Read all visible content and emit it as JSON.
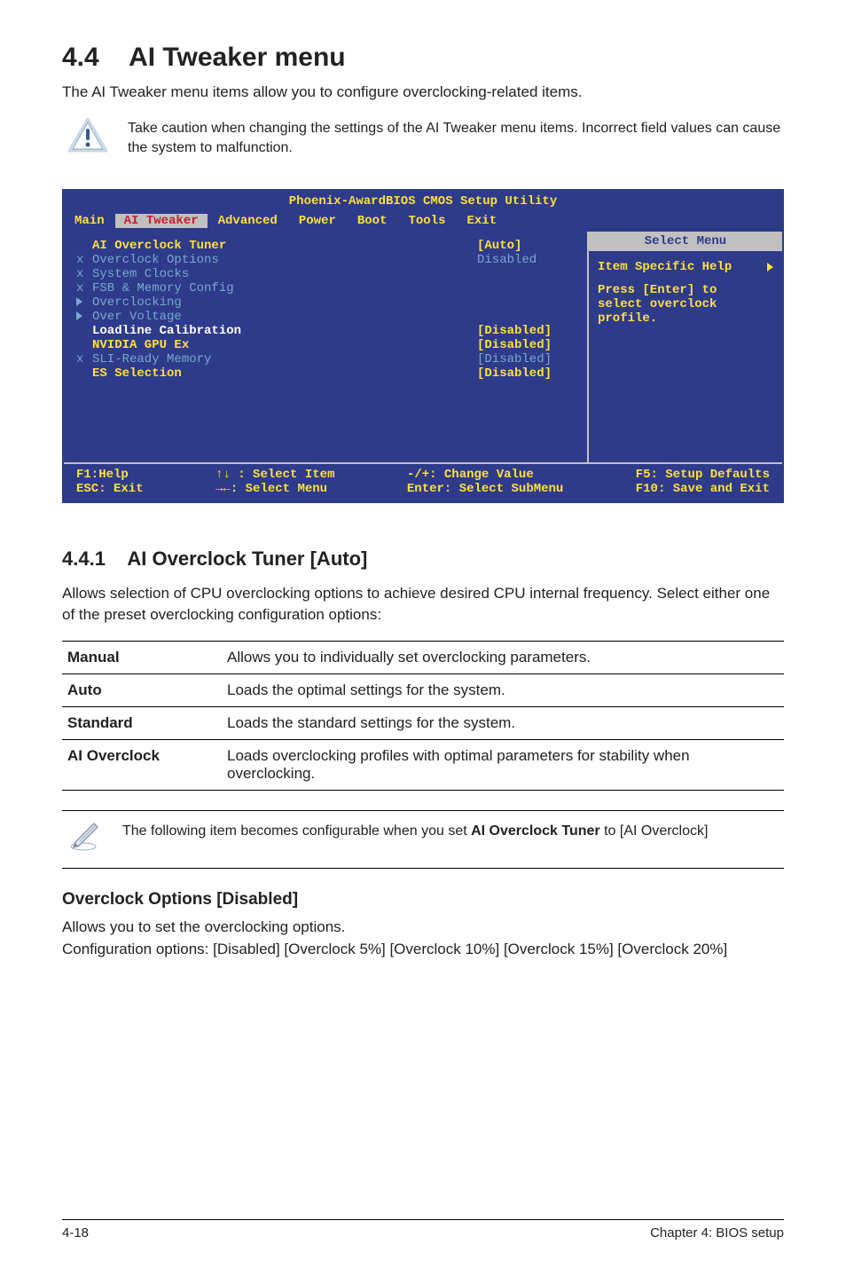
{
  "section": {
    "number": "4.4",
    "title": "AI Tweaker menu",
    "intro": "The AI Tweaker menu items allow you to configure overclocking-related items.",
    "caution": "Take caution when changing the settings of the AI Tweaker menu items. Incorrect field values can cause the system to malfunction."
  },
  "bios": {
    "window_title": "Phoenix-AwardBIOS CMOS Setup Utility",
    "tabs": [
      "Main",
      "AI Tweaker",
      "Advanced",
      "Power",
      "Boot",
      "Tools",
      "Exit"
    ],
    "active_tab": "AI Tweaker",
    "help_panel": {
      "header": "Select Menu",
      "title": "Item Specific Help",
      "body1": "Press [Enter] to",
      "body2": "select overclock",
      "body3": "profile."
    },
    "rows": [
      {
        "marker": "",
        "label": "AI Overclock Tuner",
        "value": "[Auto]",
        "bright": true,
        "white": false,
        "tri": false
      },
      {
        "marker": "x",
        "label": "Overclock Options",
        "value": "Disabled",
        "bright": false,
        "white": false,
        "tri": false,
        "plainval": true
      },
      {
        "marker": "x",
        "label": "System Clocks",
        "value": "",
        "bright": false,
        "white": false,
        "tri": false
      },
      {
        "marker": "x",
        "label": "FSB & Memory Config",
        "value": "",
        "bright": false,
        "white": false,
        "tri": false
      },
      {
        "marker": "",
        "label": "Overclocking",
        "value": "",
        "bright": false,
        "white": false,
        "tri": true
      },
      {
        "marker": "",
        "label": "Over Voltage",
        "value": "",
        "bright": false,
        "white": false,
        "tri": true
      },
      {
        "marker": "",
        "label": "Loadline Calibration",
        "value": "[Disabled]",
        "bright": true,
        "white": true,
        "tri": false
      },
      {
        "marker": "",
        "label": "NVIDIA GPU Ex",
        "value": "[Disabled]",
        "bright": true,
        "white": false,
        "tri": false
      },
      {
        "marker": "x",
        "label": "SLI-Ready Memory",
        "value": "[Disabled]",
        "bright": false,
        "white": false,
        "tri": false
      },
      {
        "marker": "",
        "label": "ES Selection",
        "value": "[Disabled]",
        "bright": true,
        "white": false,
        "tri": false
      }
    ],
    "footer": {
      "col1a": "F1:Help",
      "col1b": "ESC: Exit",
      "col2a": "↑↓ : Select Item",
      "col2b": "→←: Select Menu",
      "col3a": "-/+: Change Value",
      "col3b": "Enter: Select SubMenu",
      "col4a": "F5: Setup Defaults",
      "col4b": "F10: Save and Exit"
    }
  },
  "sub441": {
    "number": "4.4.1",
    "title": "AI Overclock Tuner [Auto]",
    "desc": "Allows selection of CPU overclocking options to achieve desired CPU internal frequency. Select either one of the preset overclocking configuration options:",
    "rows": [
      {
        "name": "Manual",
        "desc": "Allows you to individually set overclocking parameters."
      },
      {
        "name": "Auto",
        "desc": "Loads the optimal settings for the system."
      },
      {
        "name": "Standard",
        "desc": "Loads the standard settings for the system."
      },
      {
        "name": "AI Overclock",
        "desc": "Loads overclocking profiles with optimal parameters for stability when overclocking."
      }
    ],
    "note_pre": "The following item becomes configurable when you set ",
    "note_bold": "AI Overclock Tuner",
    "note_post": " to [AI Overclock]"
  },
  "overclock": {
    "heading": "Overclock Options [Disabled]",
    "line1": "Allows you to set the overclocking options.",
    "line2": "Configuration options: [Disabled] [Overclock 5%] [Overclock 10%] [Overclock 15%] [Overclock 20%]"
  },
  "footer": {
    "left": "4-18",
    "right": "Chapter 4: BIOS setup"
  }
}
